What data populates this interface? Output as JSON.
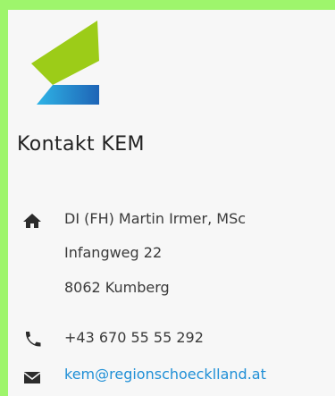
{
  "section": {
    "title": "Kontakt KEM"
  },
  "contact": {
    "address": {
      "icon": "home-icon",
      "lines": [
        "DI (FH) Martin Irmer, MSc",
        "Infangweg 22",
        "8062 Kumberg"
      ]
    },
    "phone": {
      "icon": "phone-icon",
      "value": "+43 670 55 55 292"
    },
    "email": {
      "icon": "envelope-icon",
      "value": "kem@regionschoecklland.at"
    }
  },
  "colors": {
    "page_bg": "#9ef56c",
    "card_bg": "#f7f7f7",
    "link": "#1f8fd6",
    "logo_green": "#9ccc18",
    "logo_blue": "#1e64b6"
  }
}
